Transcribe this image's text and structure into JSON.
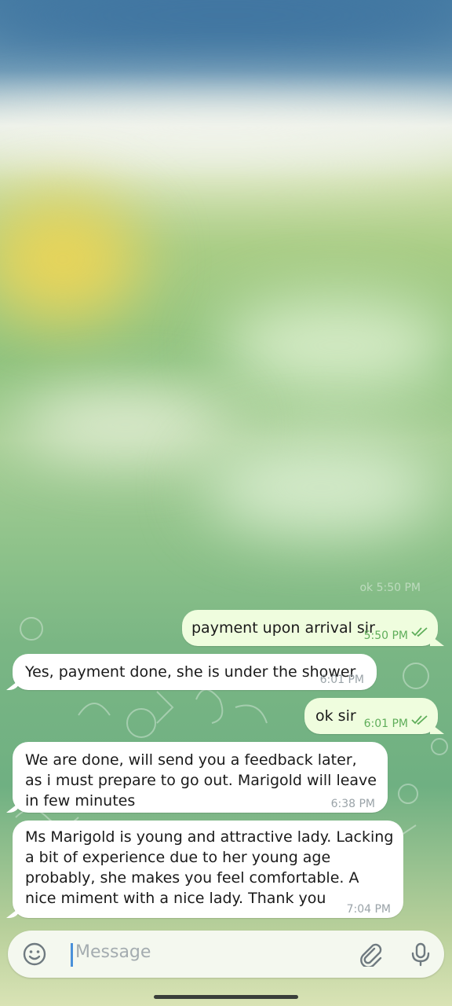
{
  "chat": {
    "ghost_label": "ok  5:50 PM",
    "messages": [
      {
        "direction": "out",
        "text": "payment upon arrival sir",
        "time": "5:50 PM",
        "read": true
      },
      {
        "direction": "in",
        "text": "Yes, payment done, she is under the shower",
        "time": "6:01 PM"
      },
      {
        "direction": "out",
        "text": "ok sir",
        "time": "6:01 PM",
        "read": true
      },
      {
        "direction": "in",
        "text": "We are done, will send you a feedback later, as i must prepare to go out. Marigold will leave in few minutes",
        "time": "6:38 PM"
      },
      {
        "direction": "in",
        "text": "Ms Marigold is young and attractive lady. Lacking a bit of experience due to her young age probably, she makes you feel comfortable. A nice miment with a nice lady. Thank you",
        "time": "7:04 PM"
      }
    ]
  },
  "composer": {
    "placeholder": "Message",
    "icons": [
      "emoji-icon",
      "attach-icon",
      "microphone-icon"
    ]
  },
  "colors": {
    "incoming_bubble": "#ffffff",
    "outgoing_bubble": "#effdde",
    "read_ticks": "#5fae5a",
    "caret": "#4a90d9"
  }
}
